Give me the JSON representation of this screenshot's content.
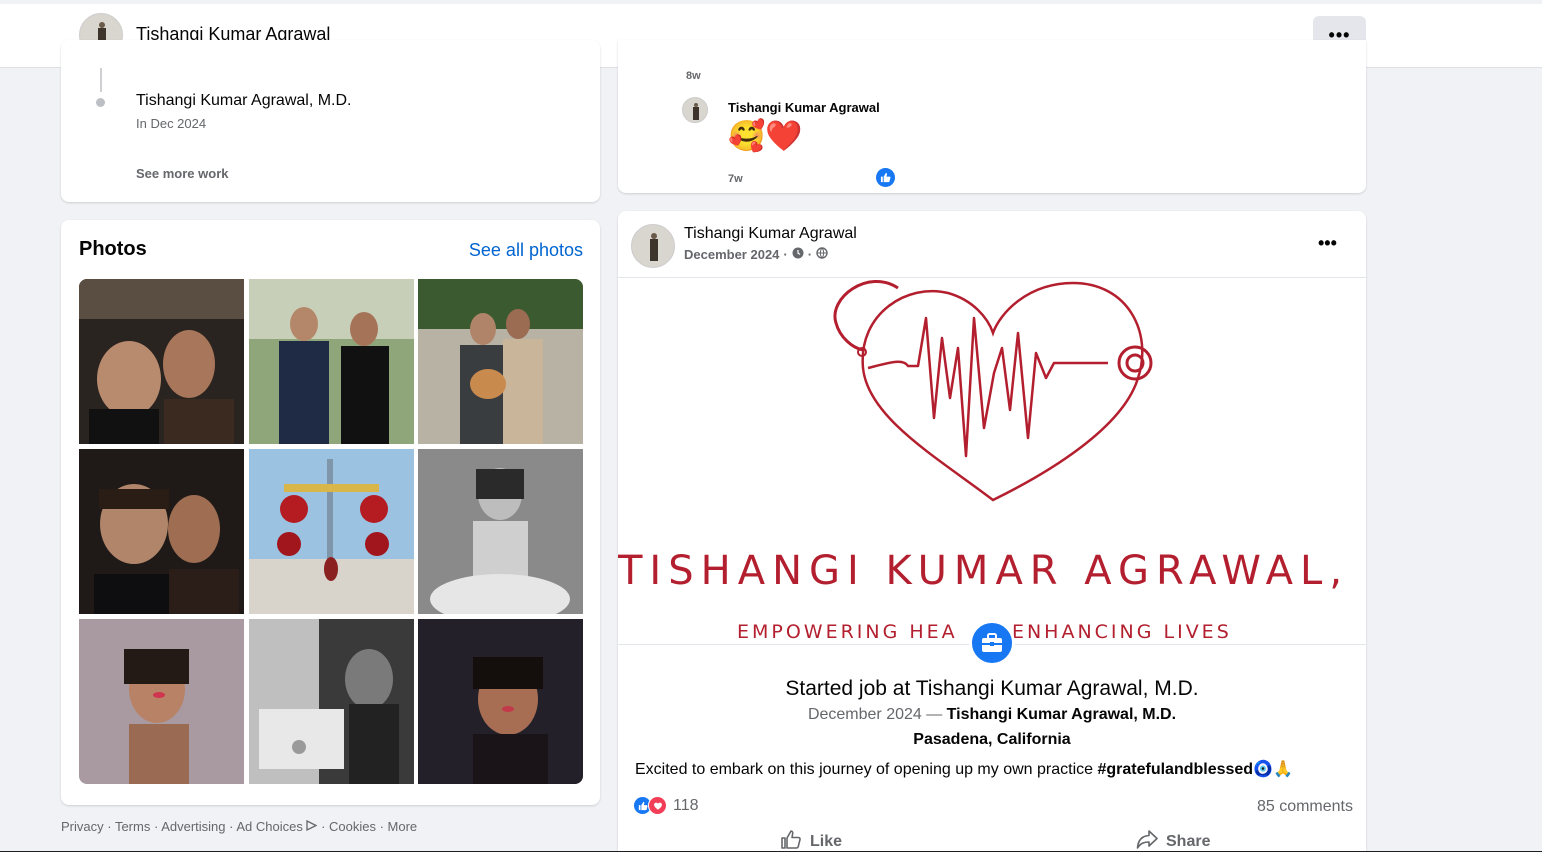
{
  "header": {
    "name": "Tishangi Kumar Agrawal",
    "more_label": "•••"
  },
  "work": {
    "job_title": "Tishangi Kumar Agrawal, M.D.",
    "job_date": "In Dec 2024",
    "see_more": "See more work"
  },
  "photos": {
    "title": "Photos",
    "see_all": "See all photos"
  },
  "footer": {
    "links": [
      "Privacy",
      "Terms",
      "Advertising",
      "Ad Choices",
      "Cookies",
      "More"
    ],
    "separator": " · "
  },
  "comment": {
    "time1": "8w",
    "name": "Tishangi Kumar Agrawal",
    "emoji": "🥰❤️",
    "time2": "7w"
  },
  "post": {
    "author": "Tishangi Kumar Agrawal",
    "date": "December 2024",
    "more_label": "•••",
    "image": {
      "brand_name": "TISHANGI KUMAR AGRAWAL, MD",
      "tagline_left": "EMPOWERING HEA",
      "tagline_right": "ENHANCING LIVES"
    },
    "event_title": "Started job at Tishangi Kumar Agrawal, M.D.",
    "event_date": "December 2024 — ",
    "event_org": "Tishangi Kumar Agrawal, M.D.",
    "event_location": "Pasadena, California",
    "text": "Excited to embark on this journey of opening up my own practice ",
    "hashtag": "#gratefulandblessed",
    "text_emoji": "🧿🙏",
    "reaction_count": "118",
    "comments_count": "85 comments",
    "like_label": "Like",
    "share_label": "Share"
  },
  "colors": {
    "brand_red": "#b31f2e",
    "facebook_blue": "#1877f2",
    "link_blue": "#0064d1"
  }
}
